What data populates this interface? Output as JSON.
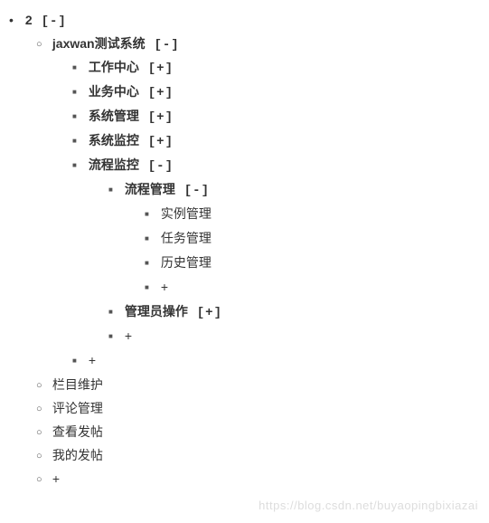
{
  "toggles": {
    "collapsed": "[+]",
    "expanded": "[-]"
  },
  "add": "+",
  "root": {
    "label": "2"
  },
  "level1": {
    "system": "jaxwan测试系统",
    "columnMaint": "栏目维护",
    "commentMgmt": "评论管理",
    "viewPost": "查看发帖",
    "myPost": "我的发帖"
  },
  "level2": {
    "workCenter": "工作中心",
    "bizCenter": "业务中心",
    "sysMgmt": "系统管理",
    "sysMonitor": "系统监控",
    "procMonitor": "流程监控"
  },
  "level3": {
    "procMgmt": "流程管理",
    "adminOp": "管理员操作"
  },
  "level4": {
    "instanceMgmt": "实例管理",
    "taskMgmt": "任务管理",
    "historyMgmt": "历史管理"
  },
  "watermark": "https://blog.csdn.net/buyaopingbixiazai"
}
